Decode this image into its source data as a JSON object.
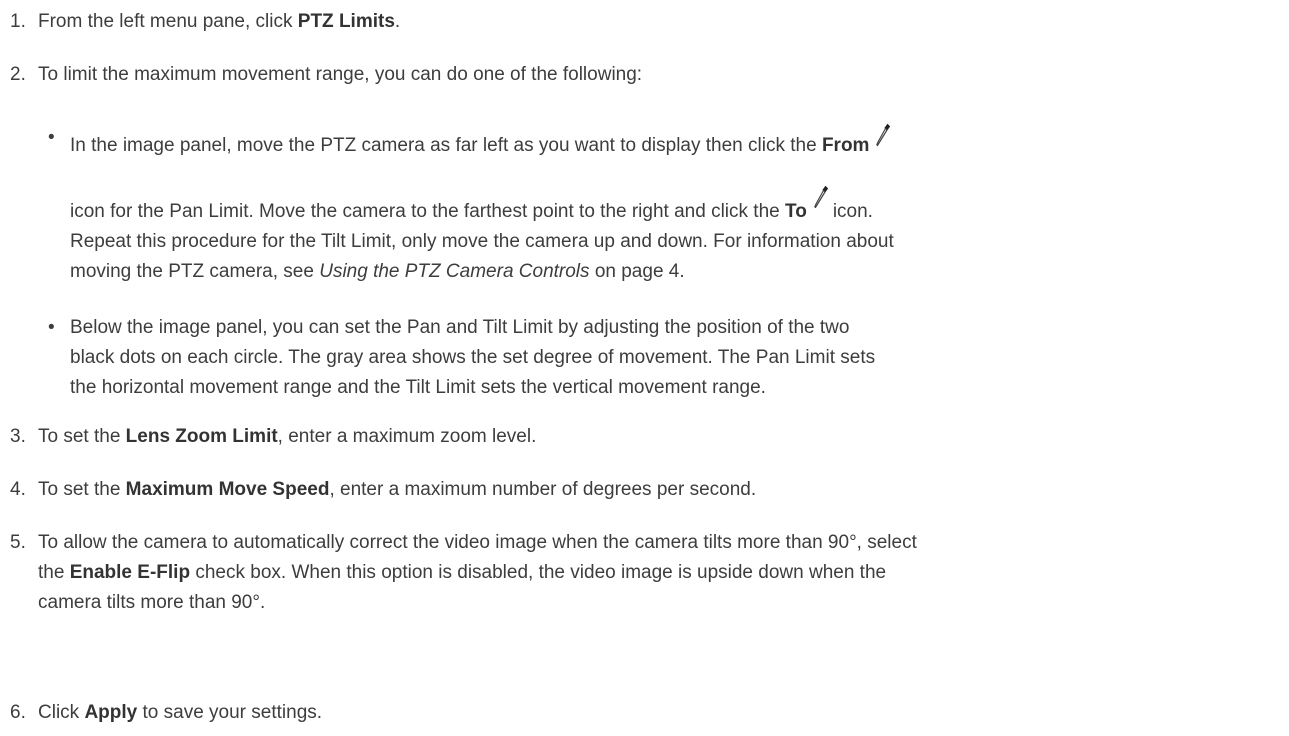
{
  "steps": [
    {
      "num": "1.",
      "pre": "From the left menu pane, click ",
      "bold": "PTZ Limits",
      "post": "."
    },
    {
      "num": "2.",
      "text": "To limit the maximum movement range, you can do one of the following:"
    },
    {
      "num": "3.",
      "pre": "To set the ",
      "bold": "Lens Zoom Limit",
      "post": ", enter a maximum zoom level."
    },
    {
      "num": "4.",
      "pre": "To set the ",
      "bold": "Maximum Move Speed",
      "post": ", enter a maximum number of degrees per second."
    },
    {
      "num": "5.",
      "line1": "To allow the camera to automatically correct the video image when the camera tilts more than 90°, select",
      "line2_pre": "the ",
      "line2_bold": "Enable E-Flip",
      "line2_post": " check box. When this option is disabled, the video image is upside down when the",
      "line3": "camera tilts more than 90°."
    },
    {
      "num": "6.",
      "pre": "Click ",
      "bold": "Apply",
      "post": " to save your settings."
    }
  ],
  "bullets": [
    {
      "line1_pre": "In the image panel, move the PTZ camera as far left as you want to display then click the ",
      "line1_bold": "From",
      "line2_pre": "icon for the Pan Limit. Move the camera to the farthest point to the right and click the ",
      "line2_bold": "To",
      "line2_post": "icon.",
      "line3": "Repeat this procedure for the Tilt Limit, only move the camera up and down. For information about",
      "line4_pre": "moving the PTZ camera, see ",
      "line4_italic": "Using the PTZ Camera Controls",
      "line4_post": " on page 4."
    },
    {
      "line1": "Below the image panel, you can set the Pan and Tilt Limit by adjusting the position of the two",
      "line2": "black dots on each circle. The gray area shows the set degree of movement. The Pan Limit sets",
      "line3": "the horizontal movement range and the Tilt Limit sets the vertical movement range."
    }
  ],
  "bullet_glyph": "•",
  "icons": {
    "from": "eyedropper-icon",
    "to": "eyedropper-icon"
  }
}
